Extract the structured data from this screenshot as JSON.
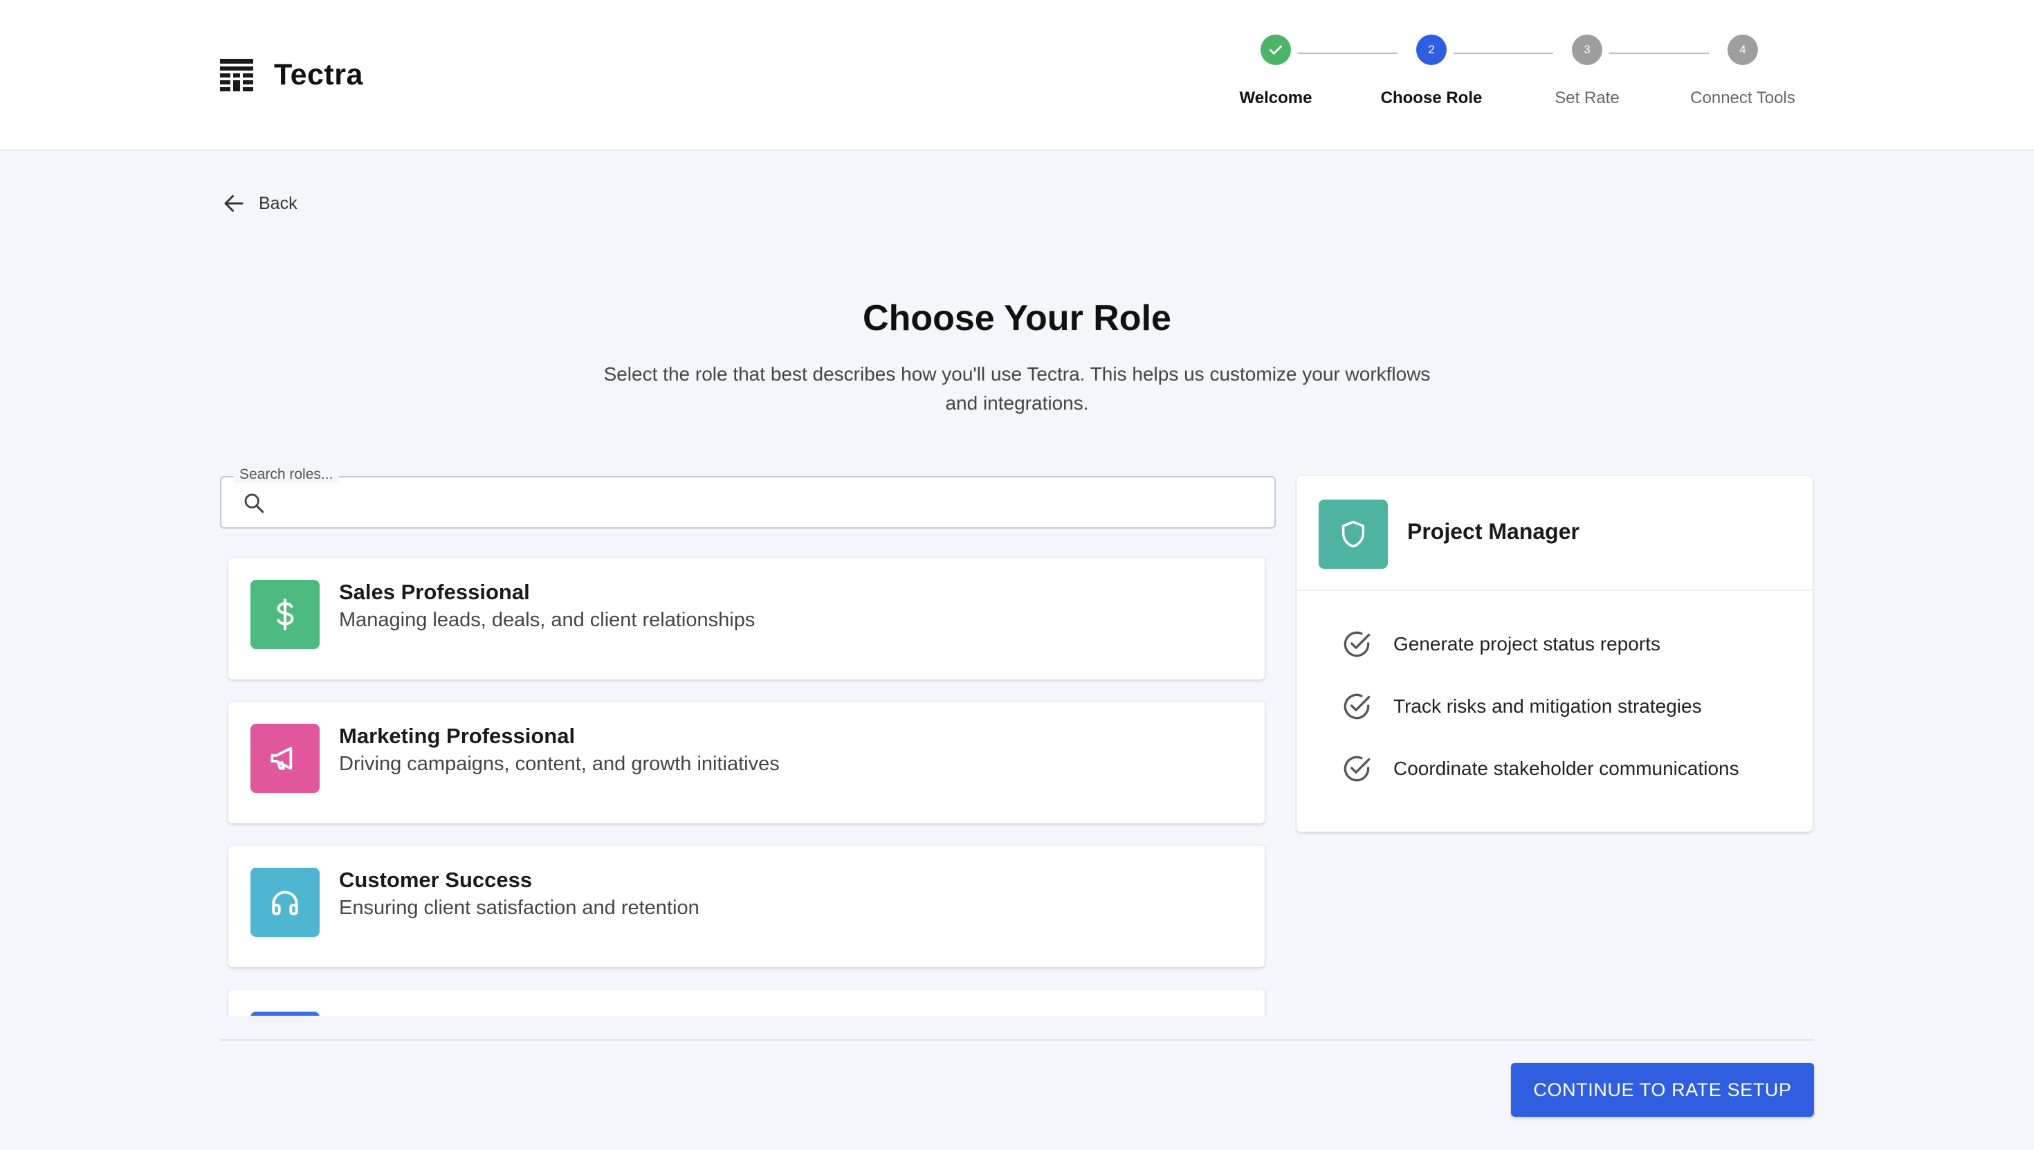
{
  "app": {
    "name": "Tectra"
  },
  "stepper": {
    "steps": [
      {
        "number": "1",
        "label": "Welcome",
        "state": "complete"
      },
      {
        "number": "2",
        "label": "Choose Role",
        "state": "active"
      },
      {
        "number": "3",
        "label": "Set Rate",
        "state": "pending"
      },
      {
        "number": "4",
        "label": "Connect Tools",
        "state": "pending"
      }
    ]
  },
  "nav": {
    "back_label": "Back"
  },
  "page": {
    "title": "Choose Your Role",
    "subtitle": "Select the role that best describes how you'll use Tectra. This helps us customize your workflows and integrations."
  },
  "search": {
    "label": "Search roles...",
    "value": ""
  },
  "roles": [
    {
      "name": "Sales Professional",
      "description": "Managing leads, deals, and client relationships",
      "icon": "dollar-icon",
      "color": "#4dbb7f"
    },
    {
      "name": "Marketing Professional",
      "description": "Driving campaigns, content, and growth initiatives",
      "icon": "megaphone-icon",
      "color": "#e0579e"
    },
    {
      "name": "Customer Success",
      "description": "Ensuring client satisfaction and retention",
      "icon": "headset-icon",
      "color": "#4eb6d1"
    },
    {
      "name": "",
      "description": "",
      "icon": "",
      "color": "#3a6fe6"
    }
  ],
  "selected_role": {
    "name": "Project Manager",
    "icon": "shield-icon",
    "color": "#4fb3a2",
    "features": [
      "Generate project status reports",
      "Track risks and mitigation strategies",
      "Coordinate stakeholder communications"
    ]
  },
  "footer": {
    "continue_label": "CONTINUE TO RATE SETUP"
  },
  "colors": {
    "primary": "#2f5fe0",
    "step_complete": "#4cb466",
    "step_active": "#2f5fe0",
    "step_pending": "#9e9e9e",
    "background": "#f4f6fb"
  }
}
